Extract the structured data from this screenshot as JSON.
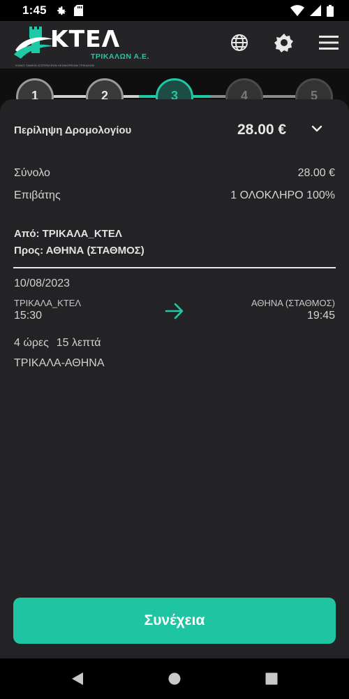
{
  "status_bar": {
    "time": "1:45",
    "left_icons": [
      "gear-icon",
      "sd-card-icon"
    ],
    "right_icons": [
      "wifi-icon",
      "signal-icon",
      "battery-icon"
    ]
  },
  "header": {
    "logo_main": "ΚΤΕΛ",
    "logo_sub": "ΤΡΙΚΑΛΩΝ Α.Ε.",
    "logo_tagline": "ΚΟΙΝΟ ΤΑΜΕΙΟ ΕΙΣΠΡΑΞΕΩΝ ΛΕΩΦΟΡΕΙΩΝ ΤΡΙΚΑΛΩΝ",
    "actions": [
      "globe-icon",
      "settings-icon",
      "menu-icon"
    ]
  },
  "stepper": {
    "steps": [
      {
        "label": "1",
        "state": "done"
      },
      {
        "label": "2",
        "state": "done"
      },
      {
        "label": "3",
        "state": "active"
      },
      {
        "label": "4",
        "state": "upcoming"
      },
      {
        "label": "5",
        "state": "upcoming"
      }
    ]
  },
  "summary": {
    "title": "Περίληψη Δρομολογίου",
    "price": "28.00 €"
  },
  "totals": [
    {
      "key": "Σύνολο",
      "value": "28.00 €"
    },
    {
      "key": "Επιβάτης",
      "value": "1 ΟΛΟΚΛΗΡΟ 100%"
    }
  ],
  "route": {
    "from": "Από: ΤΡΙΚΑΛΑ_ΚΤΕΛ",
    "to": "Προς: ΑΘΗΝΑ (ΣΤΑΘΜΟΣ)"
  },
  "trip": {
    "date": "10/08/2023",
    "from_name": "ΤΡΙΚΑΛΑ_ΚΤΕΛ",
    "from_time": "15:30",
    "to_name": "ΑΘΗΝΑ (ΣΤΑΘΜΟΣ)",
    "to_time": "19:45",
    "duration_hours": "4 ώρες",
    "duration_minutes": "15 λεπτά",
    "line": "ΤΡΙΚΑΛΑ-ΑΘΗΝΑ"
  },
  "continue_label": "Συνέχεια",
  "colors": {
    "accent": "#20c9a6",
    "background": "#0f0f10",
    "card": "#232325"
  }
}
